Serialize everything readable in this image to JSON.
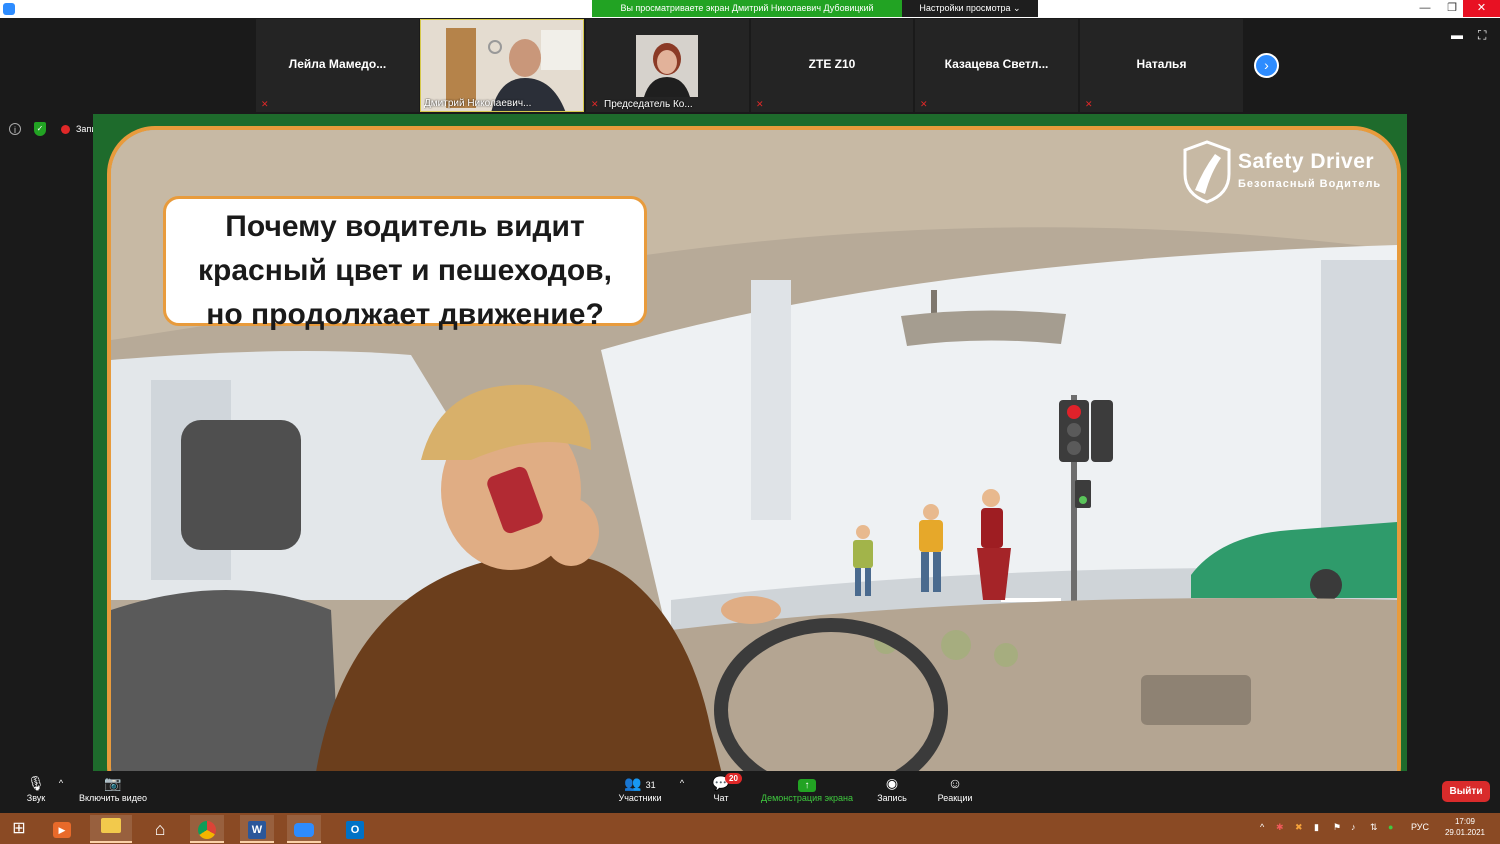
{
  "window": {
    "share_banner": "Вы просматриваете экран Дмитрий Николаевич Дубовицкий",
    "view_options": "Настройки просмотра ⌄",
    "controls": {
      "minimize": "—",
      "restore": "❐",
      "close": "✕"
    }
  },
  "participants": [
    {
      "name": "Лейла  Мамедо...",
      "video": false
    },
    {
      "name": "Дмитрий Николаевич...",
      "video": true
    },
    {
      "name": "Председатель Ко...",
      "video": true
    },
    {
      "name": "ZTE Z10",
      "video": false
    },
    {
      "name": "Казацева  Светл...",
      "video": false
    },
    {
      "name": "Наталья",
      "video": false
    }
  ],
  "recording": {
    "label": "Запись"
  },
  "slide": {
    "question": "Почему водитель видит красный цвет и пешеходов, но продолжает движение?",
    "brand_title": "Safety Driver",
    "brand_subtitle": "Безопасный Водитель"
  },
  "toolbar": {
    "audio": "Звук",
    "video": "Включить видео",
    "participants": "Участники",
    "participants_count": "31",
    "chat": "Чат",
    "chat_badge": "20",
    "share": "Демонстрация экрана",
    "record": "Запись",
    "reactions": "Реакции",
    "leave": "Выйти"
  },
  "taskbar": {
    "language": "РУС",
    "time": "17:09",
    "date": "29.01.2021"
  },
  "colors": {
    "accent": "#2d8cff",
    "share_green": "#22a323",
    "leave_red": "#d92b2b",
    "frame_orange": "#e89b3c",
    "taskbar": "#8a4a24"
  }
}
